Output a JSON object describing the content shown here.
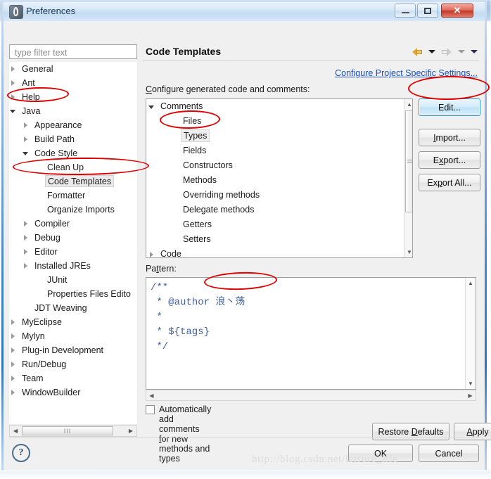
{
  "window": {
    "title": "Preferences",
    "app_icon": "eclipse-icon",
    "buttons": {
      "minimize": "minimize-button",
      "maximize": "maximize-button",
      "close": "close-button"
    }
  },
  "filter": {
    "placeholder": "type filter text",
    "value": ""
  },
  "sidebar": {
    "items": [
      {
        "label": "General",
        "indent": 0,
        "twisty": "closed",
        "selected": false
      },
      {
        "label": "Ant",
        "indent": 0,
        "twisty": "closed",
        "selected": false
      },
      {
        "label": "Help",
        "indent": 0,
        "twisty": "closed",
        "selected": false
      },
      {
        "label": "Java",
        "indent": 0,
        "twisty": "open",
        "selected": false
      },
      {
        "label": "Appearance",
        "indent": 1,
        "twisty": "closed",
        "selected": false
      },
      {
        "label": "Build Path",
        "indent": 1,
        "twisty": "closed",
        "selected": false
      },
      {
        "label": "Code Style",
        "indent": 1,
        "twisty": "open",
        "selected": false
      },
      {
        "label": "Clean Up",
        "indent": 2,
        "twisty": "none",
        "selected": false
      },
      {
        "label": "Code Templates",
        "indent": 2,
        "twisty": "none",
        "selected": true
      },
      {
        "label": "Formatter",
        "indent": 2,
        "twisty": "none",
        "selected": false
      },
      {
        "label": "Organize Imports",
        "indent": 2,
        "twisty": "none",
        "selected": false
      },
      {
        "label": "Compiler",
        "indent": 1,
        "twisty": "closed",
        "selected": false
      },
      {
        "label": "Debug",
        "indent": 1,
        "twisty": "closed",
        "selected": false
      },
      {
        "label": "Editor",
        "indent": 1,
        "twisty": "closed",
        "selected": false
      },
      {
        "label": "Installed JREs",
        "indent": 1,
        "twisty": "closed",
        "selected": false
      },
      {
        "label": "JUnit",
        "indent": 2,
        "twisty": "none",
        "selected": false
      },
      {
        "label": "Properties Files Edito",
        "indent": 2,
        "twisty": "none",
        "selected": false
      },
      {
        "label": "JDT Weaving",
        "indent": 1,
        "twisty": "none",
        "selected": false
      },
      {
        "label": "MyEclipse",
        "indent": 0,
        "twisty": "closed",
        "selected": false
      },
      {
        "label": "Mylyn",
        "indent": 0,
        "twisty": "closed",
        "selected": false
      },
      {
        "label": "Plug-in Development",
        "indent": 0,
        "twisty": "closed",
        "selected": false
      },
      {
        "label": "Run/Debug",
        "indent": 0,
        "twisty": "closed",
        "selected": false
      },
      {
        "label": "Team",
        "indent": 0,
        "twisty": "closed",
        "selected": false
      },
      {
        "label": "WindowBuilder",
        "indent": 0,
        "twisty": "closed",
        "selected": false
      }
    ],
    "hscroll": {
      "left_arrow": "◀",
      "right_arrow": "▶",
      "thumb_grip": "III"
    }
  },
  "page": {
    "title": "Code Templates",
    "project_specific_link": "Configure Project Specific Settings...",
    "configure_caption": "Configure generated code and comments:",
    "nav": {
      "back": "back-arrow",
      "back_menu": "back-dropdown",
      "forward": "forward-arrow",
      "forward_menu": "forward-dropdown",
      "menu": "view-menu-dropdown"
    }
  },
  "code_tree": {
    "items": [
      {
        "label": "Comments",
        "indent": 0,
        "twisty": "open",
        "selected": false
      },
      {
        "label": "Files",
        "indent": 1,
        "twisty": "none",
        "selected": false
      },
      {
        "label": "Types",
        "indent": 1,
        "twisty": "none",
        "selected": true
      },
      {
        "label": "Fields",
        "indent": 1,
        "twisty": "none",
        "selected": false
      },
      {
        "label": "Constructors",
        "indent": 1,
        "twisty": "none",
        "selected": false
      },
      {
        "label": "Methods",
        "indent": 1,
        "twisty": "none",
        "selected": false
      },
      {
        "label": "Overriding methods",
        "indent": 1,
        "twisty": "none",
        "selected": false
      },
      {
        "label": "Delegate methods",
        "indent": 1,
        "twisty": "none",
        "selected": false
      },
      {
        "label": "Getters",
        "indent": 1,
        "twisty": "none",
        "selected": false
      },
      {
        "label": "Setters",
        "indent": 1,
        "twisty": "none",
        "selected": false
      },
      {
        "label": "Code",
        "indent": 0,
        "twisty": "closed",
        "selected": false
      }
    ]
  },
  "buttons": {
    "edit": "Edit...",
    "import": "Import...",
    "export": "Export...",
    "export_all": "Export All...",
    "restore_defaults": "Restore Defaults",
    "apply": "Apply",
    "ok": "OK",
    "cancel": "Cancel"
  },
  "pattern": {
    "label": "Pattern:",
    "content": "/**\n * @author 浪丶荡\n *\n * ${tags}\n */",
    "scroll_up": "▲",
    "scroll_down": "▼",
    "scroll_left": "◀",
    "scroll_right": "▶"
  },
  "auto_comments": {
    "label": "Automatically add comments for new methods and types",
    "checked": false
  },
  "footer": {
    "help_icon": "?",
    "watermark": "http://blog.csdn.net/leisure_life"
  },
  "annotations": {
    "color": "#e00000",
    "marks": [
      "java-node",
      "code-templates-node",
      "types-node",
      "edit-button",
      "author-value"
    ]
  }
}
